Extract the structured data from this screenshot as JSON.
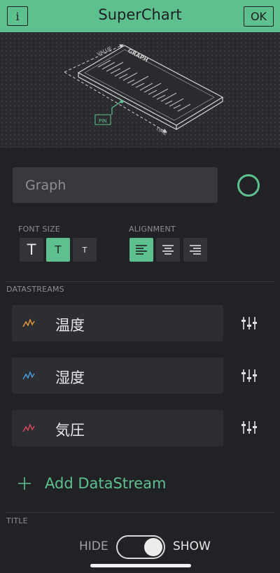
{
  "header": {
    "info_label": "i",
    "title": "SuperChart",
    "ok_label": "OK"
  },
  "illustration": {
    "graph_label": "GRAPH",
    "value_label": "VALUE",
    "time_label": "TIME",
    "pin_label": "PIN"
  },
  "name_field": {
    "placeholder": "Graph"
  },
  "font_size": {
    "label": "FONT SIZE",
    "options": [
      "T",
      "T",
      "T"
    ],
    "selected_index": 1
  },
  "alignment": {
    "label": "ALIGNMENT",
    "selected": "left"
  },
  "datastreams": {
    "section_label": "DATASTREAMS",
    "items": [
      {
        "label": "温度",
        "color": "#e89a3c",
        "icon": "line-chart-icon"
      },
      {
        "label": "湿度",
        "color": "#4a9fe0",
        "icon": "line-chart-icon"
      },
      {
        "label": "気圧",
        "color": "#d9485e",
        "icon": "line-chart-icon"
      }
    ],
    "add_label": "Add DataStream"
  },
  "title_section": {
    "label": "TITLE",
    "hide_label": "HIDE",
    "show_label": "SHOW",
    "toggle_on": true
  },
  "colors": {
    "accent": "#5ec08e",
    "background": "#212225"
  }
}
